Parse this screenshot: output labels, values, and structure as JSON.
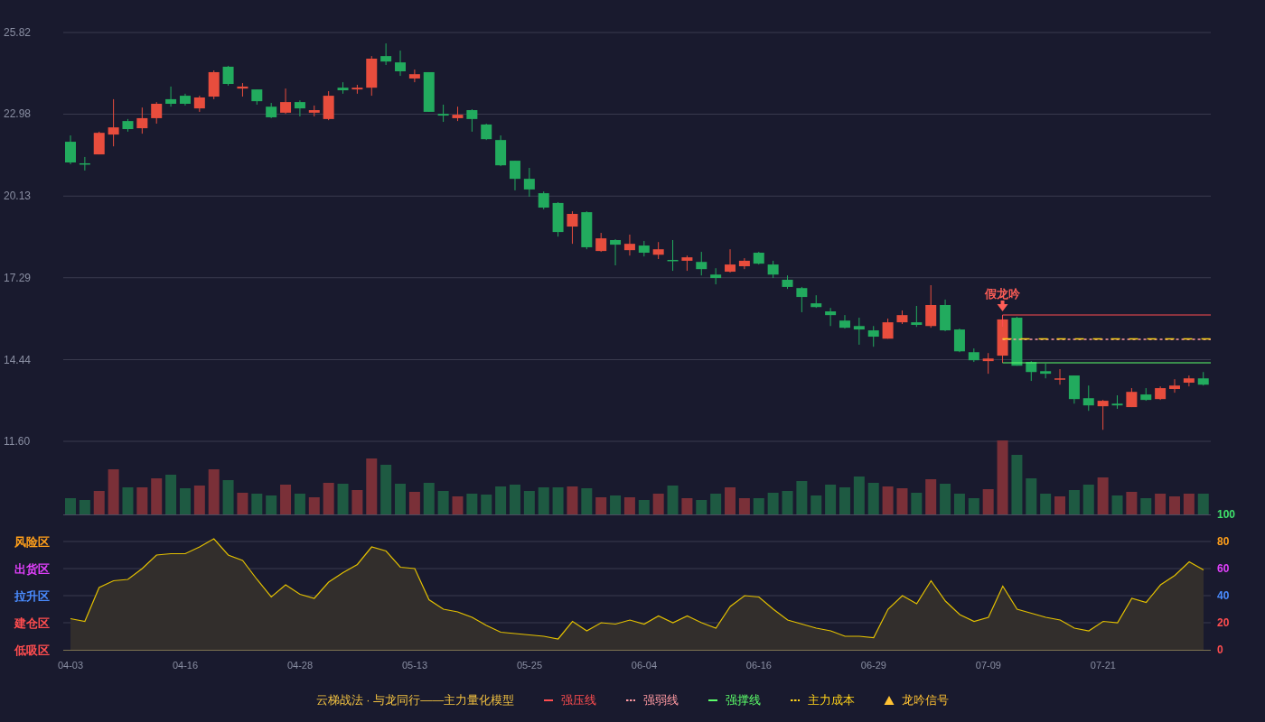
{
  "price": {
    "chart_data": {
      "type": "candlestick",
      "ylim": [
        11.6,
        25.82
      ],
      "grid": true,
      "yticks": [
        {
          "value": 25.82,
          "label": "25.82"
        },
        {
          "value": 22.98,
          "label": "22.98"
        },
        {
          "value": 20.13,
          "label": "20.13"
        },
        {
          "value": 17.29,
          "label": "17.29"
        },
        {
          "value": 14.44,
          "label": "14.44"
        },
        {
          "value": 11.6,
          "label": "11.60"
        }
      ],
      "categories": [
        null,
        null,
        null,
        null,
        null,
        null,
        null,
        null,
        null,
        null,
        null,
        null,
        null,
        null,
        null,
        null,
        null,
        null,
        null,
        null,
        null,
        null,
        null,
        null,
        null,
        null,
        null,
        null,
        null,
        null,
        null,
        null,
        null,
        null,
        null,
        null,
        null,
        null,
        null,
        null,
        null,
        null,
        null,
        null,
        null,
        null,
        null,
        null,
        null,
        null,
        null,
        null,
        null,
        null,
        null,
        null,
        null,
        null,
        null,
        null,
        null,
        null,
        null,
        null,
        null,
        null,
        null,
        null,
        null,
        null,
        null,
        null,
        null,
        null,
        null,
        null,
        null,
        null,
        null,
        null
      ],
      "ohlc": [
        [
          22.02,
          22.24,
          21.24,
          21.3
        ],
        [
          21.27,
          21.49,
          21.02,
          21.24
        ],
        [
          21.58,
          22.37,
          21.58,
          22.33
        ],
        [
          22.27,
          23.5,
          21.86,
          22.52
        ],
        [
          22.74,
          22.81,
          22.37,
          22.46
        ],
        [
          22.49,
          23.21,
          22.3,
          22.84
        ],
        [
          22.84,
          23.4,
          22.65,
          23.34
        ],
        [
          23.5,
          23.94,
          23.24,
          23.34
        ],
        [
          23.62,
          23.69,
          23.28,
          23.34
        ],
        [
          23.18,
          23.62,
          23.06,
          23.56
        ],
        [
          23.59,
          24.5,
          23.5,
          24.44
        ],
        [
          24.63,
          24.66,
          23.97,
          24.03
        ],
        [
          23.87,
          24.06,
          23.59,
          23.94
        ],
        [
          23.84,
          23.84,
          23.31,
          23.43
        ],
        [
          23.24,
          23.37,
          22.84,
          22.87
        ],
        [
          23.03,
          23.87,
          22.99,
          23.4
        ],
        [
          23.4,
          23.46,
          22.9,
          23.18
        ],
        [
          23.03,
          23.28,
          22.9,
          23.12
        ],
        [
          22.81,
          23.78,
          22.77,
          23.62
        ],
        [
          23.9,
          24.09,
          23.69,
          23.81
        ],
        [
          23.84,
          24.0,
          23.69,
          23.9
        ],
        [
          23.9,
          25.0,
          23.62,
          24.91
        ],
        [
          25.0,
          25.44,
          24.69,
          24.81
        ],
        [
          24.78,
          25.19,
          24.31,
          24.47
        ],
        [
          24.22,
          24.53,
          24.09,
          24.37
        ],
        [
          24.44,
          24.44,
          23.06,
          23.06
        ],
        [
          22.99,
          23.31,
          22.71,
          22.93
        ],
        [
          22.84,
          23.24,
          22.74,
          22.96
        ],
        [
          23.12,
          23.15,
          22.37,
          22.81
        ],
        [
          22.62,
          22.65,
          22.08,
          22.11
        ],
        [
          22.08,
          22.24,
          21.17,
          21.2
        ],
        [
          21.36,
          21.36,
          20.33,
          20.73
        ],
        [
          20.73,
          21.11,
          20.11,
          20.36
        ],
        [
          20.23,
          20.29,
          19.67,
          19.73
        ],
        [
          19.89,
          19.92,
          18.72,
          18.88
        ],
        [
          19.07,
          19.6,
          18.47,
          19.51
        ],
        [
          19.57,
          19.6,
          18.28,
          18.35
        ],
        [
          18.22,
          18.85,
          18.19,
          18.66
        ],
        [
          18.6,
          18.63,
          17.72,
          18.44
        ],
        [
          18.25,
          18.79,
          18.06,
          18.47
        ],
        [
          18.41,
          18.57,
          18.03,
          18.16
        ],
        [
          18.09,
          18.53,
          17.94,
          18.28
        ],
        [
          17.91,
          18.6,
          17.53,
          17.88
        ],
        [
          17.88,
          18.06,
          17.53,
          18.0
        ],
        [
          17.84,
          18.19,
          17.37,
          17.59
        ],
        [
          17.4,
          17.62,
          17.06,
          17.28
        ],
        [
          17.5,
          18.28,
          17.47,
          17.75
        ],
        [
          17.69,
          17.97,
          17.59,
          17.88
        ],
        [
          18.16,
          18.19,
          17.75,
          17.78
        ],
        [
          17.75,
          17.88,
          17.28,
          17.4
        ],
        [
          17.22,
          17.37,
          16.9,
          16.97
        ],
        [
          16.93,
          16.97,
          16.09,
          16.62
        ],
        [
          16.4,
          16.68,
          16.24,
          16.27
        ],
        [
          16.12,
          16.24,
          15.61,
          15.99
        ],
        [
          15.8,
          15.99,
          15.52,
          15.55
        ],
        [
          15.61,
          15.9,
          14.96,
          15.49
        ],
        [
          15.46,
          15.61,
          14.89,
          15.24
        ],
        [
          15.17,
          15.87,
          15.17,
          15.74
        ],
        [
          15.74,
          16.15,
          15.68,
          15.99
        ],
        [
          15.74,
          16.31,
          15.58,
          15.65
        ],
        [
          15.61,
          17.03,
          15.55,
          16.34
        ],
        [
          16.34,
          16.53,
          15.43,
          15.46
        ],
        [
          15.49,
          15.52,
          14.7,
          14.73
        ],
        [
          14.7,
          14.83,
          14.36,
          14.42
        ],
        [
          14.39,
          14.67,
          13.95,
          14.48
        ],
        [
          14.58,
          15.84,
          14.33,
          15.84
        ],
        [
          15.9,
          15.93,
          14.23,
          14.23
        ],
        [
          14.36,
          14.39,
          13.7,
          14.01
        ],
        [
          14.04,
          14.3,
          13.79,
          13.95
        ],
        [
          13.76,
          14.11,
          13.57,
          13.79
        ],
        [
          13.89,
          13.89,
          12.91,
          13.07
        ],
        [
          13.1,
          13.54,
          12.66,
          12.85
        ],
        [
          12.82,
          13.04,
          12.0,
          13.01
        ],
        [
          12.91,
          13.2,
          12.73,
          12.85
        ],
        [
          12.79,
          13.45,
          12.79,
          13.32
        ],
        [
          13.23,
          13.45,
          13.01,
          13.04
        ],
        [
          13.07,
          13.51,
          13.04,
          13.45
        ],
        [
          13.42,
          13.76,
          13.29,
          13.54
        ],
        [
          13.64,
          13.89,
          13.51,
          13.79
        ],
        [
          13.79,
          14.01,
          13.54,
          13.57
        ]
      ]
    }
  },
  "signal": {
    "label": "假龙吟"
  },
  "zones": [
    {
      "label": "风险区",
      "color": "#ff9f1a"
    },
    {
      "label": "出货区",
      "color": "#e040fb"
    },
    {
      "label": "拉升区",
      "color": "#4a8cff"
    },
    {
      "label": "建仓区",
      "color": "#ff4d4f"
    },
    {
      "label": "低吸区",
      "color": "#ff4d4f"
    }
  ],
  "indicator_axis": [
    {
      "color": "#3fe06b"
    },
    {
      "color": "#ff9f1a"
    },
    {
      "color": "#e040fb"
    },
    {
      "color": "#4a8cff"
    },
    {
      "color": "#ff4d4f"
    },
    {
      "color": "#ff4d4f"
    }
  ],
  "indicator": {
    "chart_data": {
      "type": "area",
      "ylim": [
        0,
        100
      ],
      "grid": true,
      "yticks": [
        {
          "value": 100,
          "label": "100"
        },
        {
          "value": 80,
          "label": "80"
        },
        {
          "value": 60,
          "label": "60"
        },
        {
          "value": 40,
          "label": "40"
        },
        {
          "value": 20,
          "label": "20"
        },
        {
          "value": 0,
          "label": "0"
        }
      ],
      "categories": [
        "04-03",
        null,
        null,
        null,
        null,
        null,
        null,
        null,
        "04-16",
        null,
        null,
        null,
        null,
        null,
        null,
        null,
        "04-28",
        null,
        null,
        null,
        null,
        null,
        null,
        null,
        "05-13",
        null,
        null,
        null,
        null,
        null,
        null,
        null,
        "05-25",
        null,
        null,
        null,
        null,
        null,
        null,
        null,
        "06-04",
        null,
        null,
        null,
        null,
        null,
        null,
        null,
        "06-16",
        null,
        null,
        null,
        null,
        null,
        null,
        null,
        "06-29",
        null,
        null,
        null,
        null,
        null,
        null,
        null,
        "07-09",
        null,
        null,
        null,
        null,
        null,
        null,
        null,
        "07-21",
        null,
        null,
        null,
        null,
        null,
        null,
        null
      ],
      "values": [
        23,
        21,
        46,
        51,
        52,
        60,
        70,
        71,
        71,
        76,
        82,
        70,
        66,
        52,
        39,
        48,
        41,
        38,
        50,
        57,
        63,
        76,
        73,
        61,
        60,
        37,
        30,
        28,
        24,
        18,
        13,
        12,
        11,
        10,
        8,
        21,
        14,
        20,
        19,
        22,
        19,
        25,
        20,
        25,
        20,
        16,
        32,
        40,
        39,
        30,
        22,
        19,
        16,
        14,
        10,
        10,
        9,
        30,
        40,
        34,
        51,
        36,
        26,
        21,
        24,
        47,
        30,
        27,
        24,
        22,
        16,
        14,
        21,
        20,
        38,
        35,
        48,
        55,
        65,
        59
      ]
    }
  },
  "legend": {
    "title": "云梯战法 · 与龙同行——主力量化模型",
    "items": [
      {
        "kind": "solid",
        "label": "强压线",
        "color": "#ff4d4f"
      },
      {
        "kind": "dashed",
        "label": "强弱线",
        "color": "#ff9aa2"
      },
      {
        "kind": "solid",
        "label": "强撑线",
        "color": "#5cff6a"
      },
      {
        "kind": "dashed",
        "label": "主力成本",
        "color": "#ffd21a"
      },
      {
        "kind": "triangle",
        "label": "龙吟信号",
        "color": "#ffc233"
      }
    ]
  }
}
